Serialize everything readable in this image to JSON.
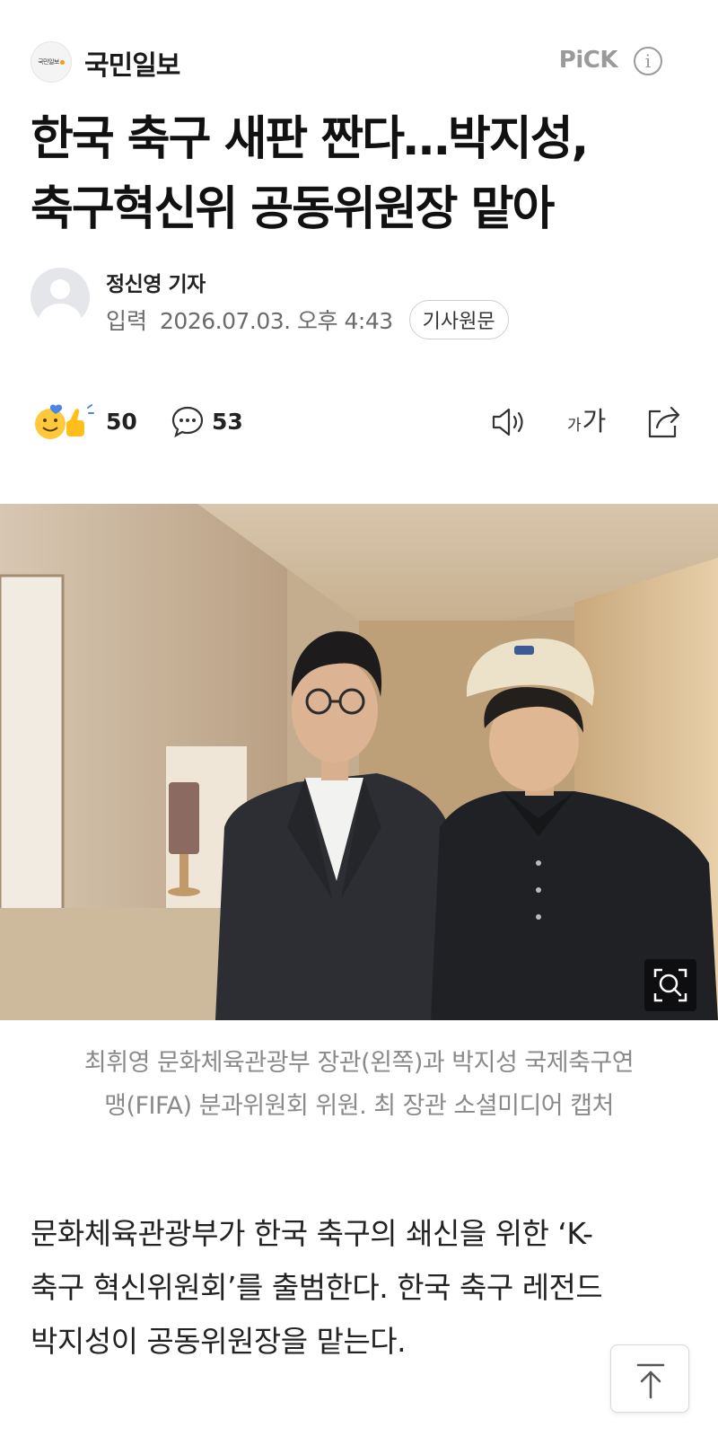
{
  "publisher": {
    "logo_text": "국민일보",
    "name": "국민일보",
    "pick_label": "PiCK",
    "info_icon": "info-icon"
  },
  "article": {
    "headline_line1": "한국 축구 새판 짠다…박지성,",
    "headline_line2": "축구혁신위 공동위원장 맡아",
    "reporter": "정신영 기자",
    "date_label": "입력",
    "date_value": "2026.07.03. 오후 4:43",
    "original_button": "기사원문"
  },
  "actions": {
    "reaction_icon": "reaction-emoji-icon",
    "reaction_count": "50",
    "comment_icon": "comment-icon",
    "comment_count": "53",
    "speaker_icon": "speaker-icon",
    "fontsize_small": "가",
    "fontsize_big": "가",
    "share_icon": "share-icon"
  },
  "photo": {
    "zoom_icon": "zoom-search-icon",
    "caption_line1": "최휘영 문화체육관광부 장관(왼쪽)과 박지성 국제축구연",
    "caption_line2": "맹(FIFA) 분과위원회 위원. 최 장관 소셜미디어 캡처"
  },
  "body": {
    "line1": "문화체육관광부가 한국 축구의 쇄신을 위한 ‘K-",
    "line2": "축구 혁신위원회’를 출범한다. 한국 축구 레전드",
    "line3": "박지성이 공동위원장을 맡는다."
  },
  "top_button_icon": "arrow-up-icon",
  "colors": {
    "logo_dot": "#f39a1e",
    "muted_text": "#8a8a8a",
    "pick": "#9a9a9a"
  }
}
